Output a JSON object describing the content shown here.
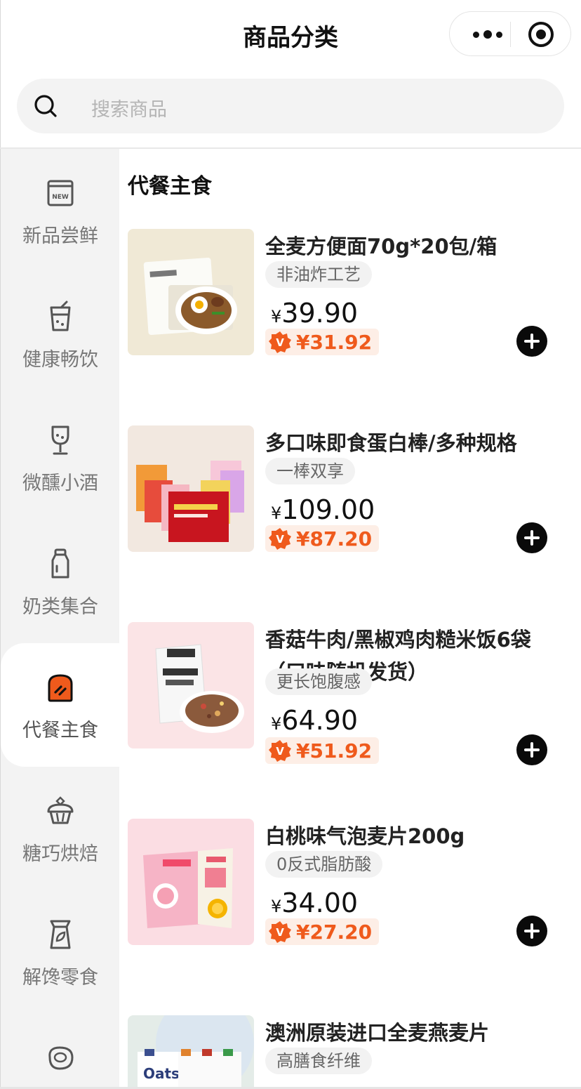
{
  "header": {
    "title": "商品分类",
    "more_icon": "more-dots-icon",
    "target_icon": "target-circle-icon"
  },
  "search": {
    "placeholder": "搜索商品",
    "icon": "search-icon"
  },
  "sidebar": {
    "items": [
      {
        "label": "新品尝鲜",
        "icon": "new-badge-icon",
        "active": false
      },
      {
        "label": "健康畅饮",
        "icon": "drink-cup-icon",
        "active": false
      },
      {
        "label": "微醺小酒",
        "icon": "wine-glass-icon",
        "active": false
      },
      {
        "label": "奶类集合",
        "icon": "milk-bottle-icon",
        "active": false
      },
      {
        "label": "代餐主食",
        "icon": "toast-bread-icon",
        "active": true
      },
      {
        "label": "糖巧烘焙",
        "icon": "cupcake-icon",
        "active": false
      },
      {
        "label": "解馋零食",
        "icon": "snack-bag-icon",
        "active": false
      },
      {
        "label": "",
        "icon": "meat-steak-icon",
        "active": false
      }
    ]
  },
  "content": {
    "section_title": "代餐主食",
    "products": [
      {
        "name": "全麦方便面70g*20包/箱",
        "tag": "非油炸工艺",
        "price": "39.90",
        "vip_price": "¥31.92",
        "image": "noodle-pack-image",
        "bg": "#f0e9d6"
      },
      {
        "name": "多口味即食蛋白棒/多种规格",
        "tag": "一棒双享",
        "price": "109.00",
        "vip_price": "¥87.20",
        "image": "protein-bar-boxes-image",
        "bg": "#f2e8e0"
      },
      {
        "name": "香菇牛肉/黑椒鸡肉糙米饭6袋（口味随机发货）",
        "tag": "更长饱腹感",
        "price": "64.90",
        "vip_price": "¥51.92",
        "image": "brown-rice-bag-image",
        "bg": "#fbe4e6"
      },
      {
        "name": "白桃味气泡麦片200g",
        "tag": "0反式脂肪酸",
        "price": "34.00",
        "vip_price": "¥27.20",
        "image": "oat-cereal-bags-image",
        "bg": "#fbdde3"
      },
      {
        "name": "澳洲原装进口全麦燕麦片",
        "tag": "高膳食纤维",
        "price": "",
        "vip_price": "",
        "image": "oats-packages-image",
        "bg": "#e4ece8"
      }
    ]
  },
  "colors": {
    "accent": "#ef5a1c",
    "vip_bg": "#fdeee6",
    "sidebar_bg": "#f3f3f3"
  },
  "currency_symbol": "¥"
}
